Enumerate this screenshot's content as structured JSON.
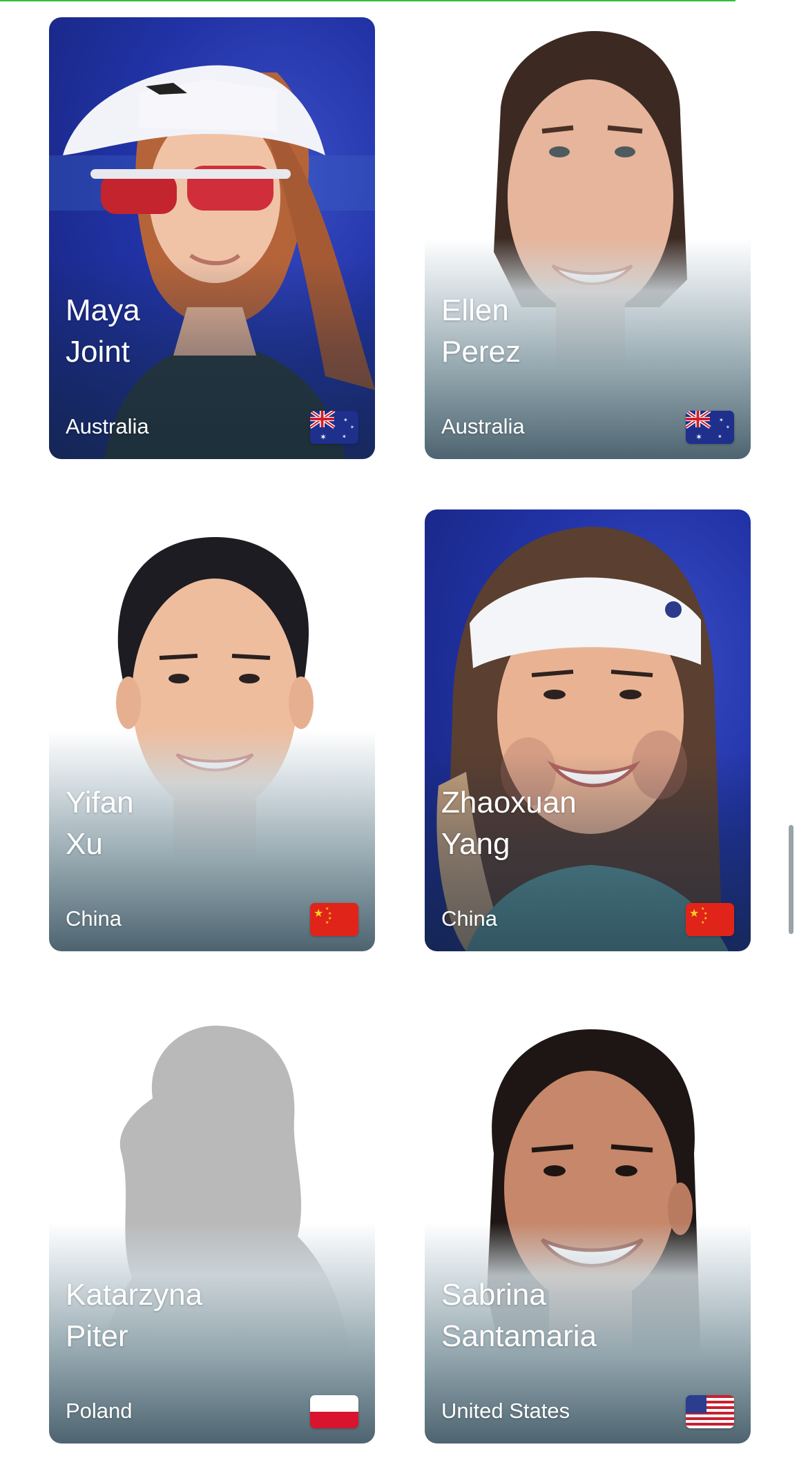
{
  "players": [
    {
      "first_name": "Maya",
      "last_name": "Joint",
      "country": "Australia",
      "flag": "australia-flag"
    },
    {
      "first_name": "Ellen",
      "last_name": "Perez",
      "country": "Australia",
      "flag": "australia-flag"
    },
    {
      "first_name": "Yifan",
      "last_name": "Xu",
      "country": "China",
      "flag": "china-flag"
    },
    {
      "first_name": "Zhaoxuan",
      "last_name": "Yang",
      "country": "China",
      "flag": "china-flag"
    },
    {
      "first_name": "Katarzyna",
      "last_name": "Piter",
      "country": "Poland",
      "flag": "poland-flag"
    },
    {
      "first_name": "Sabrina",
      "last_name": "Santamaria",
      "country": "United States",
      "flag": "usa-flag"
    }
  ],
  "colors": {
    "accent_line": "#2fbf3a",
    "court_blue": "#2133a6",
    "fade_dark": "#4d6470"
  }
}
